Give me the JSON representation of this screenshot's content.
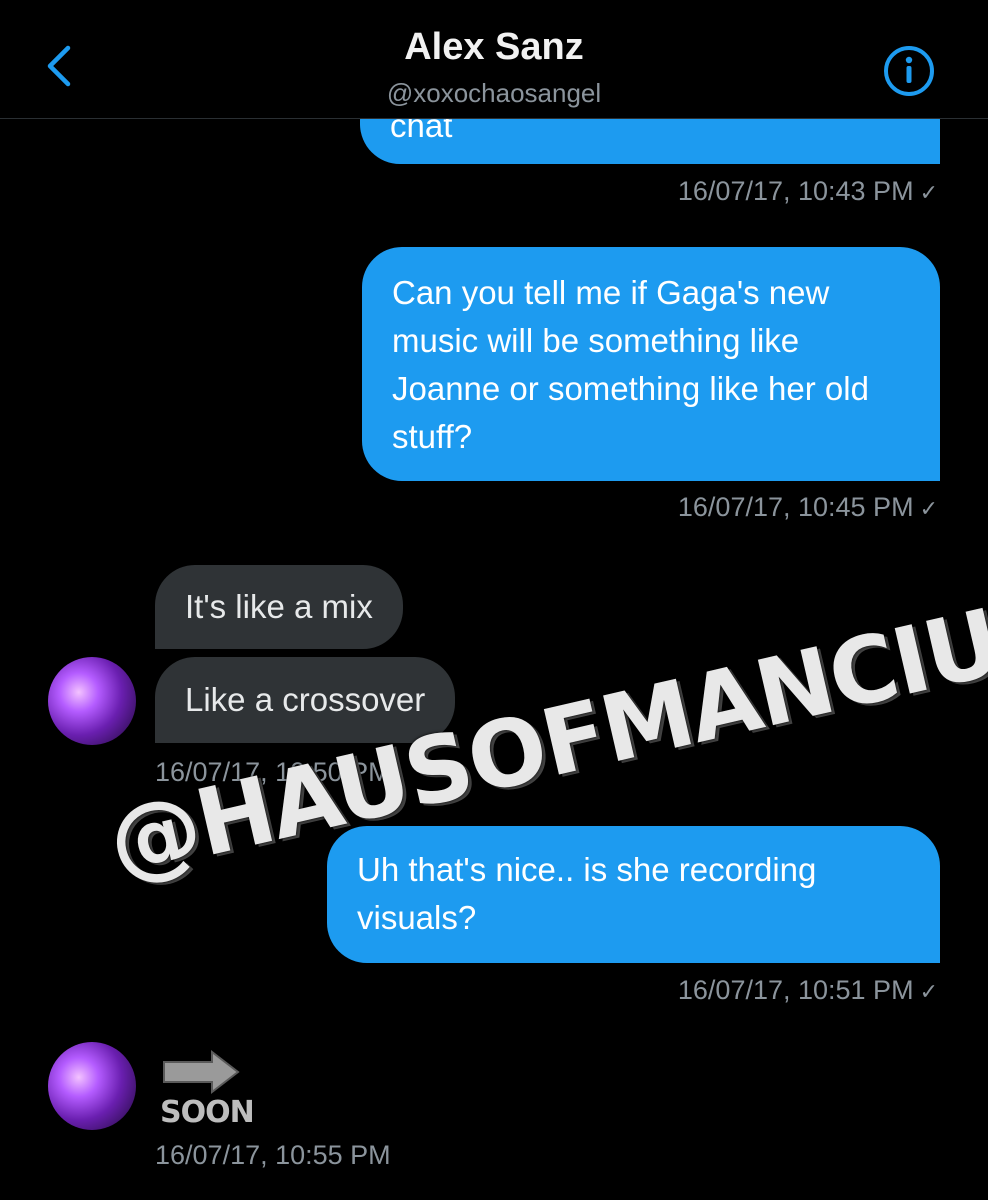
{
  "header": {
    "title": "Alex Sanz",
    "handle": "@xoxochaosangel",
    "back_icon": "chevron-left-icon",
    "info_icon": "info-icon",
    "accent_color": "#1d9bf0"
  },
  "messages": [
    {
      "direction": "outgoing",
      "text": "chat",
      "timestamp": "16/07/17, 10:43 PM",
      "status": "✓"
    },
    {
      "direction": "outgoing",
      "text": "Can you tell me if Gaga's new music will be something like Joanne or something like her old stuff?",
      "timestamp": "16/07/17, 10:45 PM",
      "status": "✓"
    },
    {
      "direction": "incoming",
      "text": "It's like a mix"
    },
    {
      "direction": "incoming",
      "text": "Like a crossover",
      "timestamp": "16/07/17, 10:50 PM"
    },
    {
      "direction": "outgoing",
      "text": "Uh that's nice.. is she recording visuals?",
      "timestamp": "16/07/17, 10:51 PM",
      "status": "✓"
    },
    {
      "direction": "incoming",
      "sticker": "arrow-right-soon-icon",
      "sticker_text": "SOON",
      "timestamp": "16/07/17, 10:55 PM"
    }
  ],
  "watermark": "@HAUSOFMANCIURE",
  "colors": {
    "outgoing_bubble": "#1d9bf0",
    "incoming_bubble": "#2f3336",
    "timestamp": "#8b949c",
    "background": "#000000"
  }
}
